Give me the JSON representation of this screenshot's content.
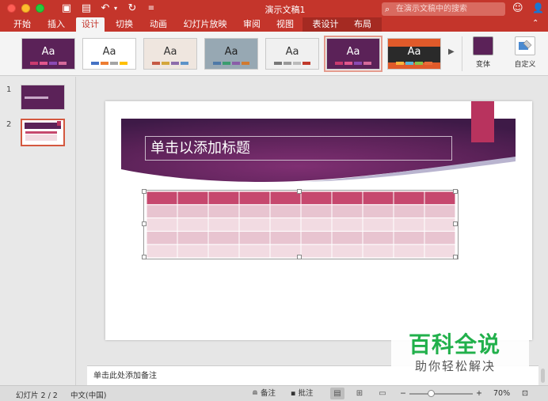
{
  "window": {
    "title": "演示文稿1",
    "search_placeholder": "在演示文稿中的搜索"
  },
  "tabs": [
    {
      "label": "开始"
    },
    {
      "label": "插入"
    },
    {
      "label": "设计",
      "active": true
    },
    {
      "label": "切换"
    },
    {
      "label": "动画"
    },
    {
      "label": "幻灯片放映"
    },
    {
      "label": "审阅"
    },
    {
      "label": "视图"
    },
    {
      "label": "表设计"
    },
    {
      "label": "布局"
    }
  ],
  "ribbon": {
    "theme_label": "Aa",
    "variants_label": "变体",
    "customize_label": "自定义"
  },
  "slides": [
    {
      "number": "1"
    },
    {
      "number": "2"
    }
  ],
  "slide": {
    "title_placeholder": "单击以添加标题"
  },
  "notes": {
    "placeholder": "单击此处添加备注"
  },
  "status": {
    "slide_counter": "幻灯片 2 / 2",
    "language": "中文(中国)",
    "notes_label": "备注",
    "comments_label": "批注",
    "zoom": "70%"
  },
  "watermark": {
    "title": "百科全说",
    "subtitle": "助你轻松解决"
  },
  "colors": {
    "accent": "#c4352b",
    "slide_purple": "#5a2356",
    "table_header": "#c6486e",
    "table_row_light": "#f2dbe2",
    "table_row_mid": "#e8c4d0"
  }
}
